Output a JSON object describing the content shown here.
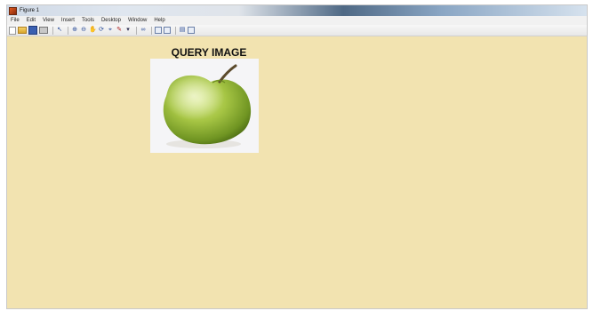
{
  "window": {
    "title": "Figure 1"
  },
  "menu": {
    "items": [
      "File",
      "Edit",
      "View",
      "Insert",
      "Tools",
      "Desktop",
      "Window",
      "Help"
    ]
  },
  "toolbar": {
    "icons": [
      "new-figure-icon",
      "open-file-icon",
      "save-figure-icon",
      "print-figure-icon",
      "edit-plot-icon",
      "zoom-in-icon",
      "zoom-out-icon",
      "pan-icon",
      "rotate-3d-icon",
      "data-cursor-icon",
      "brush-icon",
      "link-plot-icon",
      "insert-colorbar-icon",
      "insert-legend-icon",
      "hide-plot-tools-icon",
      "show-plot-tools-icon"
    ]
  },
  "axes": {
    "title": "QUERY IMAGE"
  },
  "colors": {
    "figure_background": "#f2e3b0",
    "apple_green": "#9cbf3c"
  }
}
